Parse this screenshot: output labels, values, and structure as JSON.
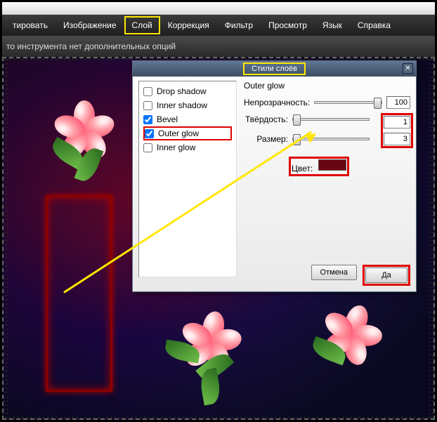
{
  "menu": {
    "items": [
      {
        "label": "тировать"
      },
      {
        "label": "Изображение"
      },
      {
        "label": "Слой",
        "highlight": true
      },
      {
        "label": "Коррекция"
      },
      {
        "label": "Фильтр"
      },
      {
        "label": "Просмотр"
      },
      {
        "label": "Язык"
      },
      {
        "label": "Справка"
      }
    ]
  },
  "options_bar": {
    "text": "то инструмента нет дополнительных опций"
  },
  "dialog": {
    "title": "Стили слоёв",
    "close_label": "✕",
    "effects": [
      {
        "label": "Drop shadow",
        "checked": false
      },
      {
        "label": "Inner shadow",
        "checked": false
      },
      {
        "label": "Bevel",
        "checked": true
      },
      {
        "label": "Outer glow",
        "checked": true,
        "highlight": true
      },
      {
        "label": "Inner glow",
        "checked": false
      }
    ],
    "pane": {
      "title": "Outer glow",
      "rows": {
        "opacity": {
          "label": "Непрозрачность:",
          "value": "100",
          "thumb_pct": 100
        },
        "hardness": {
          "label": "Твёрдость:",
          "value": "1",
          "thumb_pct": 0
        },
        "size": {
          "label": "Размер:",
          "value": "3",
          "thumb_pct": 0
        },
        "color": {
          "label": "Цвет:",
          "hex": "#6a0612"
        }
      }
    },
    "buttons": {
      "cancel": "Отмена",
      "ok": "Да"
    }
  }
}
